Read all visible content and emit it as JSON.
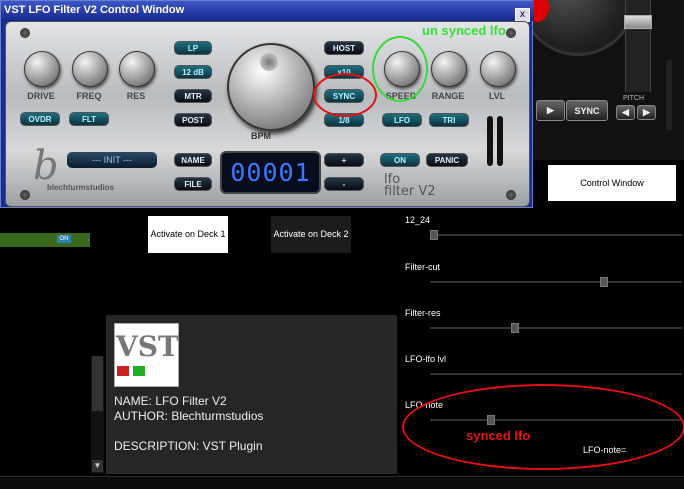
{
  "plugin_window": {
    "title": "VST LFO Filter V2 Control Window",
    "close_label": "x",
    "knobs": [
      {
        "label": "DRIVE"
      },
      {
        "label": "FREQ"
      },
      {
        "label": "RES"
      },
      {
        "label": "SPEED"
      },
      {
        "label": "RANGE"
      },
      {
        "label": "LVL"
      }
    ],
    "buttons": {
      "ovdr": "OVDR",
      "flt": "FLT",
      "lp": "LP",
      "db": "12 dB",
      "mtr": "MTR",
      "post": "POST",
      "host": "HOST",
      "x10": "x10",
      "sync": "SYNC",
      "ratio": "1/8",
      "lfo": "LFO",
      "tri": "TRI",
      "name": "NAME",
      "file": "FILE",
      "plus": "+",
      "minus": "-",
      "on": "ON",
      "panic": "PANIC"
    },
    "bpm_label": "BPM",
    "preset": "--- INIT ---",
    "lcd_value": "00001",
    "brand": "blechturmstudios",
    "product_line1": "lfo",
    "product_line2": "filter V2"
  },
  "annotations": {
    "unsynced": "un synced lfo",
    "synced": "synced lfo"
  },
  "deck": {
    "play_icon": "play-icon",
    "sync_label": "SYNC",
    "pitch_label": "PITCH",
    "control_window_button": "Control Window"
  },
  "activate": {
    "deck1": "Activate on Deck 1",
    "deck2": "Activate on Deck 2"
  },
  "green_toggle": "ON",
  "params": [
    {
      "label": "12_24",
      "value": 0.0
    },
    {
      "label": "Filter-cut",
      "value": 0.69
    },
    {
      "label": "Filter-res",
      "value": 0.33
    },
    {
      "label": "LFO-lfo lvl",
      "value": null
    },
    {
      "label": "LFO-note",
      "value": 0.23
    }
  ],
  "lfo_note_readout": "LFO-note=",
  "info": {
    "logo_text": "VST",
    "name": "NAME: LFO Filter V2",
    "author": "AUTHOR: Blechturmstudios",
    "description": "DESCRIPTION: VST Plugin"
  },
  "colors": {
    "title_bar": "#1e35a8",
    "annotation_green": "#33e233",
    "annotation_red": "#e51111",
    "lcd": "#3e78ff"
  }
}
